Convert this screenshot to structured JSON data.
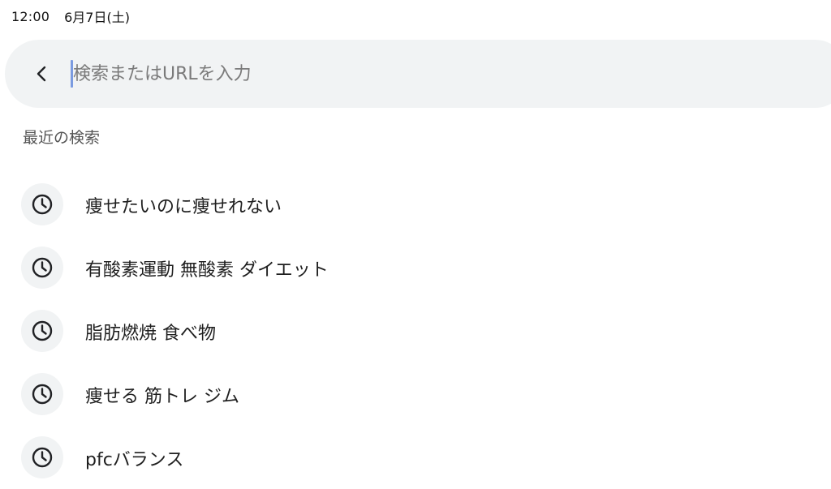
{
  "status_bar": {
    "time": "12:00",
    "date": "6月7日(土)"
  },
  "search": {
    "placeholder": "検索またはURLを入力",
    "value": ""
  },
  "recent": {
    "title": "最近の検索",
    "items": [
      {
        "label": "痩せたいのに痩せれない",
        "icon": "clock-icon"
      },
      {
        "label": "有酸素運動 無酸素 ダイエット",
        "icon": "clock-icon"
      },
      {
        "label": "脂肪燃焼 食べ物",
        "icon": "clock-icon"
      },
      {
        "label": "痩せる 筋トレ ジム",
        "icon": "clock-icon"
      },
      {
        "label": "pfcバランス",
        "icon": "clock-icon"
      }
    ]
  },
  "colors": {
    "search_bg": "#f1f3f4",
    "cursor": "#7b9be0",
    "icon_bg": "#f1f3f4"
  }
}
